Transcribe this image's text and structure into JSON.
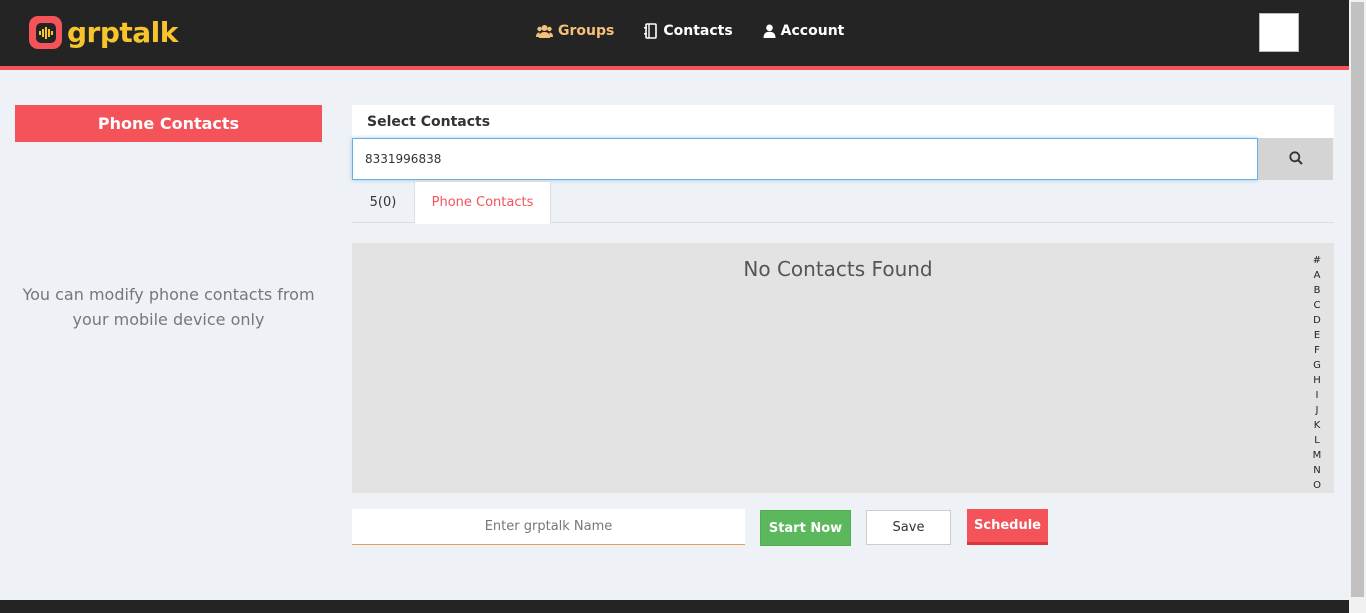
{
  "brand": {
    "name": "grptalk",
    "logo_icon": "waveform-icon",
    "accent": "#f5535a",
    "name_color": "#f7c52b"
  },
  "nav": {
    "items": [
      {
        "label": "Groups",
        "icon": "users-icon",
        "active": true
      },
      {
        "label": "Contacts",
        "icon": "address-book-icon",
        "active": false
      },
      {
        "label": "Account",
        "icon": "user-icon",
        "active": false
      }
    ]
  },
  "left_panel": {
    "title": "Phone Contacts",
    "note": "You can modify phone contacts from your mobile device only"
  },
  "select": {
    "title": "Select Contacts",
    "search_value": "8331996838",
    "search_icon": "search-icon"
  },
  "tabs": [
    {
      "label": "5(0)",
      "active": false
    },
    {
      "label": "Phone Contacts",
      "active": true
    }
  ],
  "contacts": {
    "empty_message": "No Contacts Found",
    "alphabet": [
      "#",
      "A",
      "B",
      "C",
      "D",
      "E",
      "F",
      "G",
      "H",
      "I",
      "J",
      "K",
      "L",
      "M",
      "N",
      "O"
    ]
  },
  "actions": {
    "name_placeholder": "Enter grptalk Name",
    "start_label": "Start Now",
    "save_label": "Save",
    "schedule_label": "Schedule"
  }
}
